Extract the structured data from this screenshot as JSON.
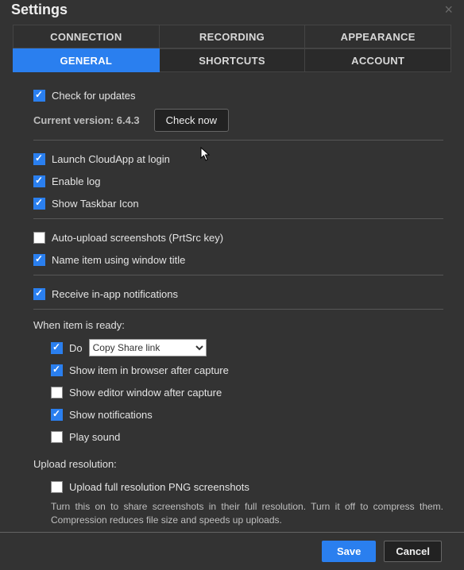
{
  "window": {
    "title": "Settings",
    "close": "×"
  },
  "tabs": {
    "row1": [
      "CONNECTION",
      "RECORDING",
      "APPEARANCE"
    ],
    "row2": [
      "GENERAL",
      "SHORTCUTS",
      "ACCOUNT"
    ],
    "active": "GENERAL"
  },
  "updates": {
    "check_label": "Check for updates",
    "version_label": "Current version: 6.4.3",
    "button": "Check now"
  },
  "startup": {
    "launch": "Launch CloudApp at login",
    "log": "Enable log",
    "taskbar": "Show Taskbar Icon"
  },
  "upload": {
    "auto": "Auto-upload screenshots (PrtSrc key)",
    "name": "Name item using window title"
  },
  "notify": {
    "receive": "Receive in-app notifications"
  },
  "ready": {
    "heading": "When item is ready:",
    "do_label": "Do",
    "do_option": "Copy Share link",
    "browser": "Show item in browser after capture",
    "editor": "Show editor window after capture",
    "notifications": "Show notifications",
    "sound": "Play sound"
  },
  "resolution": {
    "heading": "Upload resolution:",
    "full": "Upload full resolution PNG screenshots",
    "help": "Turn this on to share screenshots in their full resolution. Turn it off to compress them. Compression reduces file size and speeds up uploads."
  },
  "footer": {
    "save": "Save",
    "cancel": "Cancel"
  }
}
